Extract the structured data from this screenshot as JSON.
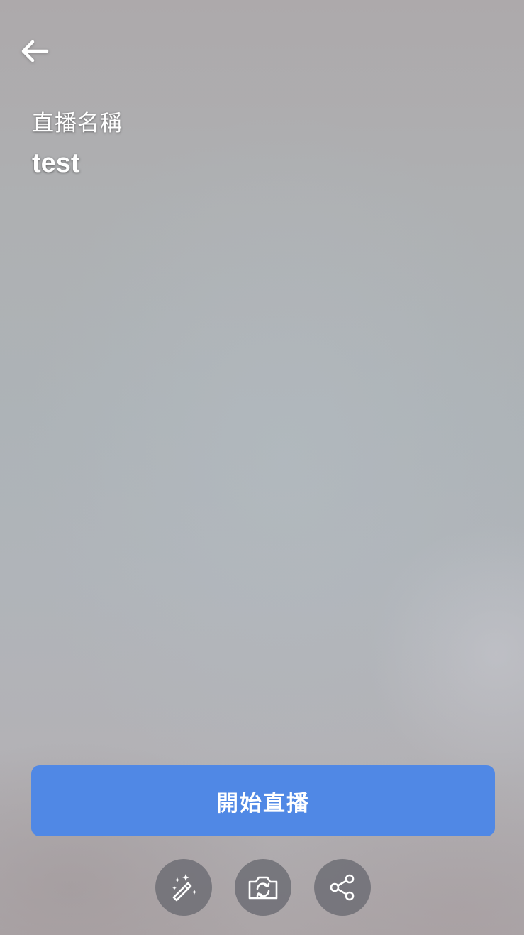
{
  "header": {
    "back_icon": "arrow-left-icon"
  },
  "stream": {
    "name_label": "直播名稱",
    "name_value": "test"
  },
  "actions": {
    "start_label": "開始直播",
    "start_color": "#5088e5",
    "icons": [
      "magic-wand-icon",
      "camera-flip-icon",
      "share-icon"
    ]
  }
}
